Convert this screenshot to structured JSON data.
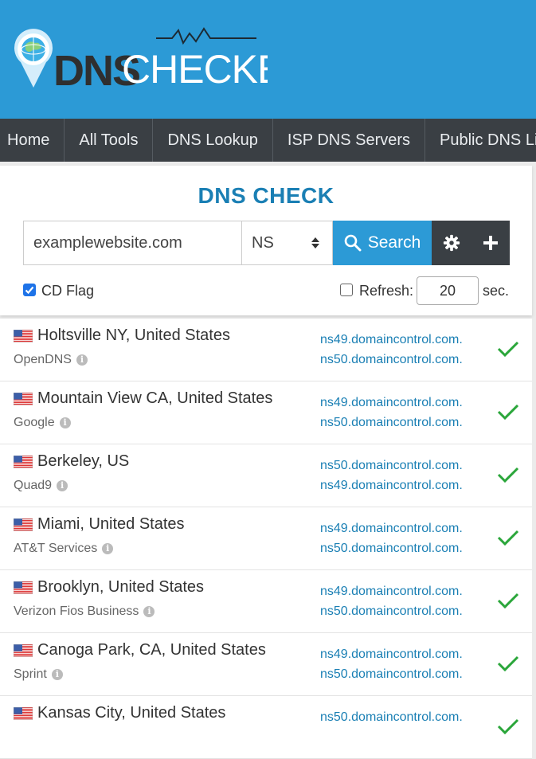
{
  "logo": {
    "text_dns": "DNS",
    "text_checker": "CHECKER"
  },
  "nav": [
    "Home",
    "All Tools",
    "DNS Lookup",
    "ISP DNS Servers",
    "Public DNS List"
  ],
  "page_title": "DNS CHECK",
  "search": {
    "domain_value": "examplewebsite.com",
    "record_type": "NS",
    "button_label": "Search"
  },
  "options": {
    "cd_flag_label": "CD Flag",
    "cd_flag_checked": true,
    "refresh_label": "Refresh:",
    "refresh_checked": false,
    "refresh_value": "20",
    "refresh_unit": "sec."
  },
  "results": [
    {
      "location": "Holtsville NY, United States",
      "provider": "OpenDNS",
      "ns": [
        "ns49.domaincontrol.com.",
        "ns50.domaincontrol.com."
      ],
      "status": "ok"
    },
    {
      "location": "Mountain View CA, United States",
      "provider": "Google",
      "ns": [
        "ns49.domaincontrol.com.",
        "ns50.domaincontrol.com."
      ],
      "status": "ok"
    },
    {
      "location": "Berkeley, US",
      "provider": "Quad9",
      "ns": [
        "ns50.domaincontrol.com.",
        "ns49.domaincontrol.com."
      ],
      "status": "ok"
    },
    {
      "location": "Miami, United States",
      "provider": "AT&T Services",
      "ns": [
        "ns49.domaincontrol.com.",
        "ns50.domaincontrol.com."
      ],
      "status": "ok"
    },
    {
      "location": "Brooklyn, United States",
      "provider": "Verizon Fios Business",
      "ns": [
        "ns49.domaincontrol.com.",
        "ns50.domaincontrol.com."
      ],
      "status": "ok"
    },
    {
      "location": "Canoga Park, CA, United States",
      "provider": "Sprint",
      "ns": [
        "ns49.domaincontrol.com.",
        "ns50.domaincontrol.com."
      ],
      "status": "ok"
    },
    {
      "location": "Kansas City, United States",
      "provider": "",
      "ns": [
        "ns50.domaincontrol.com."
      ],
      "status": "ok"
    }
  ],
  "colors": {
    "header_bg": "#2c9ad6",
    "nav_bg": "#3a3f44",
    "title": "#1a7fb4",
    "ok_check": "#2aa63a"
  }
}
